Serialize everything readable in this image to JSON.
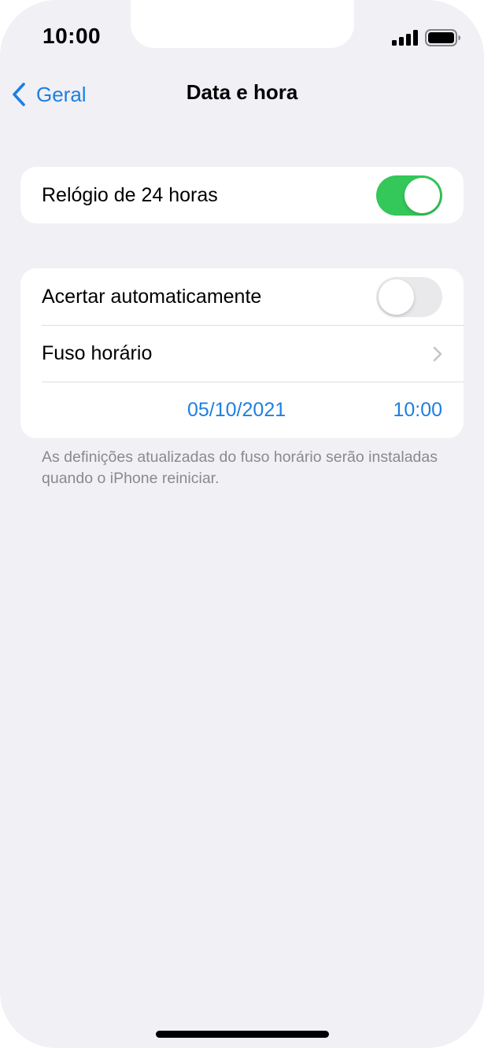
{
  "status_bar": {
    "time": "10:00"
  },
  "nav": {
    "back_label": "Geral",
    "title": "Data e hora"
  },
  "settings": {
    "clock_24h": {
      "label": "Relógio de 24 horas",
      "enabled": true
    },
    "set_automatically": {
      "label": "Acertar automaticamente",
      "enabled": false
    },
    "time_zone": {
      "label": "Fuso horário"
    },
    "date": "05/10/2021",
    "time": "10:00"
  },
  "footnote": "As definições atualizadas do fuso horário serão instaladas quando o iPhone reiniciar.",
  "colors": {
    "accent": "#1f7fe0",
    "toggle_on": "#34c759",
    "toggle_off": "#e9e9eb",
    "background": "#f0f0f5"
  }
}
